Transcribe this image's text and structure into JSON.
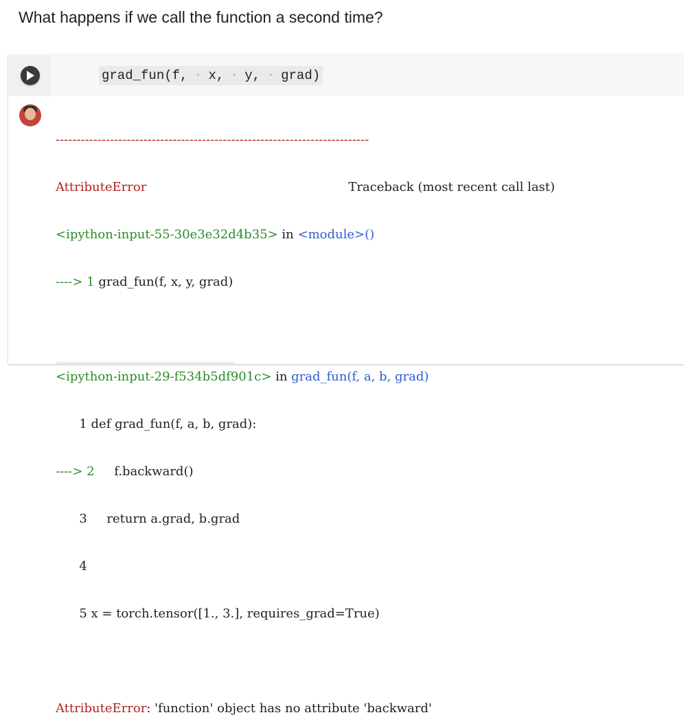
{
  "markdown": {
    "text": "What happens if we call the function a second time?"
  },
  "cell": {
    "code": {
      "fn": "grad_fun",
      "open": "(",
      "arg1": "f,",
      "arg2": "x,",
      "arg3": "y,",
      "arg4": "grad",
      "close": ")",
      "space_marker": "•"
    }
  },
  "output": {
    "separator": "---------------------------------------------------------------------------",
    "header_error": "AttributeError",
    "header_traceback": "Traceback (most recent call last)",
    "frame1_file": "<ipython-input-55-30e3e32d4b35>",
    "frame1_in": " in ",
    "frame1_module": "<module>()",
    "frame1_arrow": "----> 1 ",
    "frame1_code": "grad_fun(f, x, y, grad)",
    "frame2_file": "<ipython-input-29-f534b5df901c>",
    "frame2_in": " in ",
    "frame2_func": "grad_fun(f, a, b, grad)",
    "frame2_line1_num": "      1 ",
    "frame2_line1_code": "def grad_fun(f, a, b, grad):",
    "frame2_line2_arrow": "----> 2 ",
    "frame2_line2_code": "    f.backward()",
    "frame2_line3_num": "      3 ",
    "frame2_line3_code": "    return a.grad, b.grad",
    "frame2_line4_num": "      4",
    "frame2_line5_num": "      5 ",
    "frame2_line5_code": "x = torch.tensor([1., 3.], requires_grad=True)",
    "final_error_type": "AttributeError",
    "final_error_msg": ": 'function' object has no attribute 'backward'"
  },
  "colors": {
    "traceback_green": "#2a8a2a",
    "traceback_blue": "#2d5bd1",
    "error_red": "#b22222"
  },
  "icons": {
    "run": "play-icon",
    "avatar": "user-avatar"
  }
}
